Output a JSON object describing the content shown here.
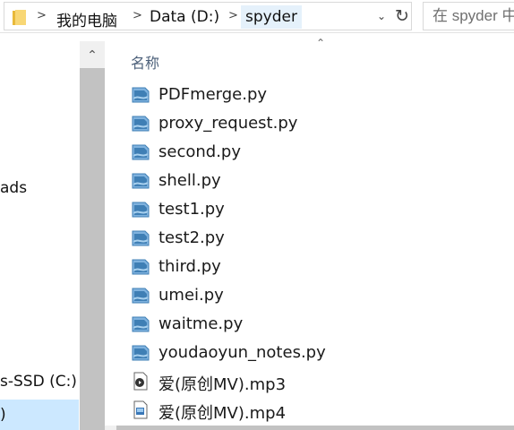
{
  "address_bar": {
    "crumbs": [
      "我的电脑",
      "Data (D:)",
      "spyder"
    ],
    "search_placeholder": "在 spyder 中搜"
  },
  "nav_pane": {
    "items": [
      "ads",
      "s-SSD (C:)",
      ")"
    ]
  },
  "content": {
    "column_header": "名称",
    "files": [
      {
        "name": "PDFmerge.py",
        "icon": "python-file-icon"
      },
      {
        "name": "proxy_request.py",
        "icon": "python-file-icon"
      },
      {
        "name": "second.py",
        "icon": "python-file-icon"
      },
      {
        "name": "shell.py",
        "icon": "python-file-icon"
      },
      {
        "name": "test1.py",
        "icon": "python-file-icon"
      },
      {
        "name": "test2.py",
        "icon": "python-file-icon"
      },
      {
        "name": "third.py",
        "icon": "python-file-icon"
      },
      {
        "name": "umei.py",
        "icon": "python-file-icon"
      },
      {
        "name": "waitme.py",
        "icon": "python-file-icon"
      },
      {
        "name": "youdaoyun_notes.py",
        "icon": "python-file-icon"
      },
      {
        "name": "爱(原创MV).mp3",
        "icon": "audio-file-icon"
      },
      {
        "name": "爱(原创MV).mp4",
        "icon": "video-file-icon"
      }
    ]
  },
  "colors": {
    "selection": "#cce8ff",
    "header_text": "#4c607a",
    "folder_yellow": "#f8d775",
    "python_blue": "#3f7fb5"
  }
}
